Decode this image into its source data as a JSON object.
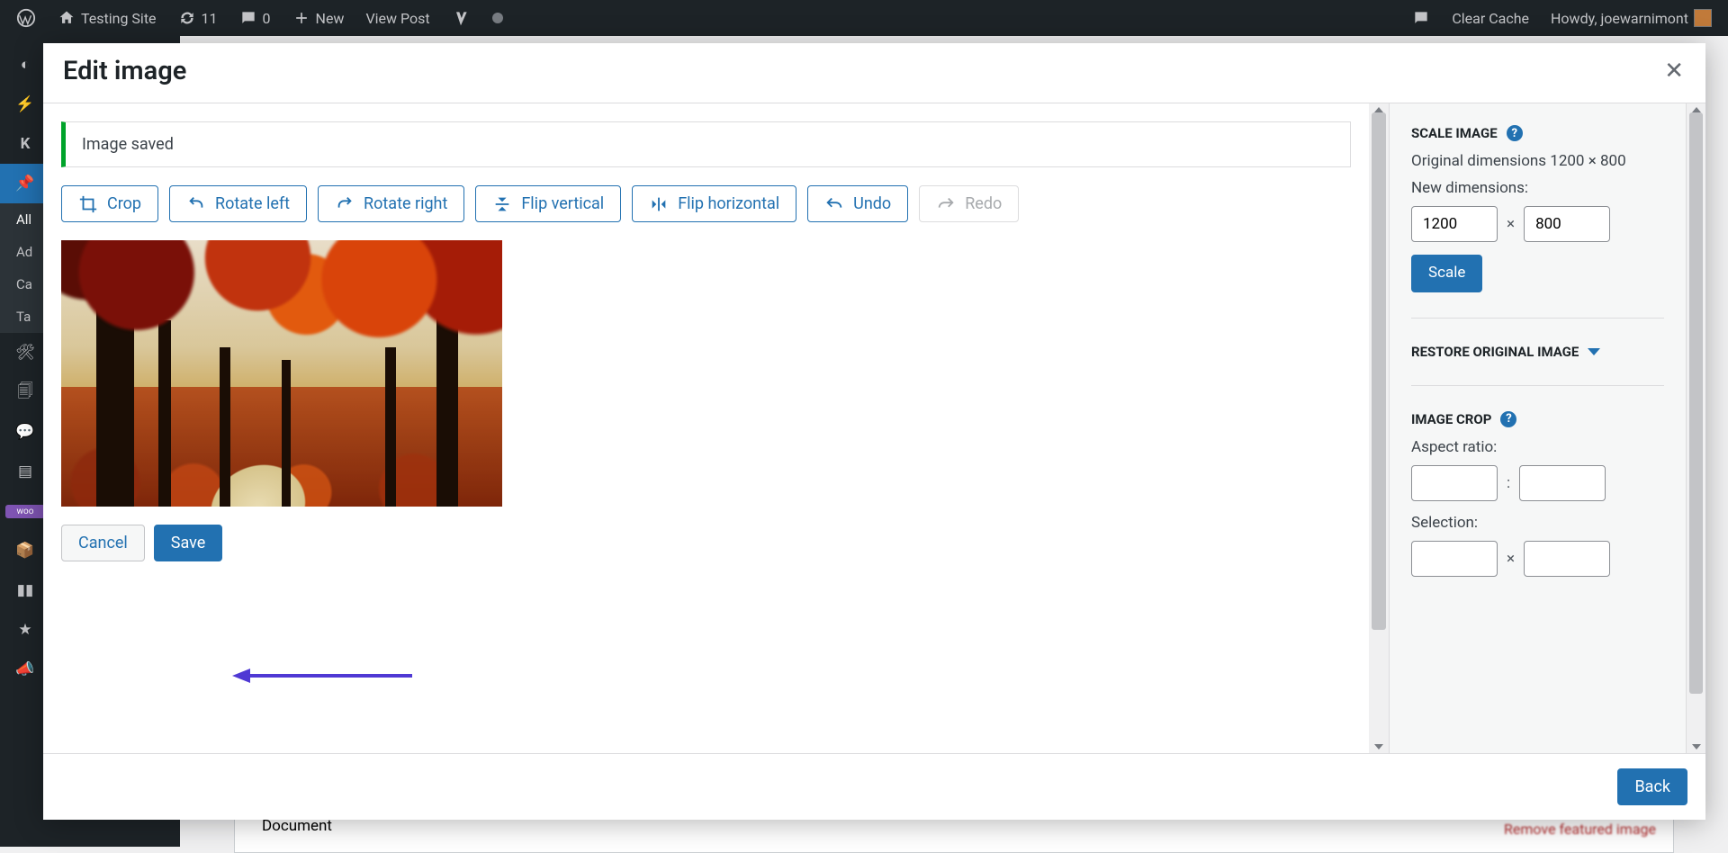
{
  "adminbar": {
    "site_name": "Testing Site",
    "updates": "11",
    "comments": "0",
    "new": "New",
    "view_post": "View Post",
    "clear_cache": "Clear Cache",
    "greeting": "Howdy, joewarnimont"
  },
  "sidebar": {
    "submenu": {
      "all": "All",
      "add": "Ad",
      "cat": "Ca",
      "tag": "Ta"
    },
    "marketing": "Marketing"
  },
  "bg": {
    "document": "Document",
    "remove": "Remove featured image"
  },
  "modal": {
    "title": "Edit image",
    "notice": "Image saved",
    "toolbar": {
      "crop": "Crop",
      "rotate_left": "Rotate left",
      "rotate_right": "Rotate right",
      "flip_v": "Flip vertical",
      "flip_h": "Flip horizontal",
      "undo": "Undo",
      "redo": "Redo"
    },
    "actions": {
      "cancel": "Cancel",
      "save": "Save"
    },
    "back": "Back"
  },
  "panel": {
    "scale_heading": "SCALE IMAGE",
    "orig_label": "Original dimensions 1200 × 800",
    "new_dim_label": "New dimensions:",
    "width": "1200",
    "height": "800",
    "scale_btn": "Scale",
    "restore_heading": "RESTORE ORIGINAL IMAGE",
    "crop_heading": "IMAGE CROP",
    "aspect_label": "Aspect ratio:",
    "selection_label": "Selection:"
  }
}
